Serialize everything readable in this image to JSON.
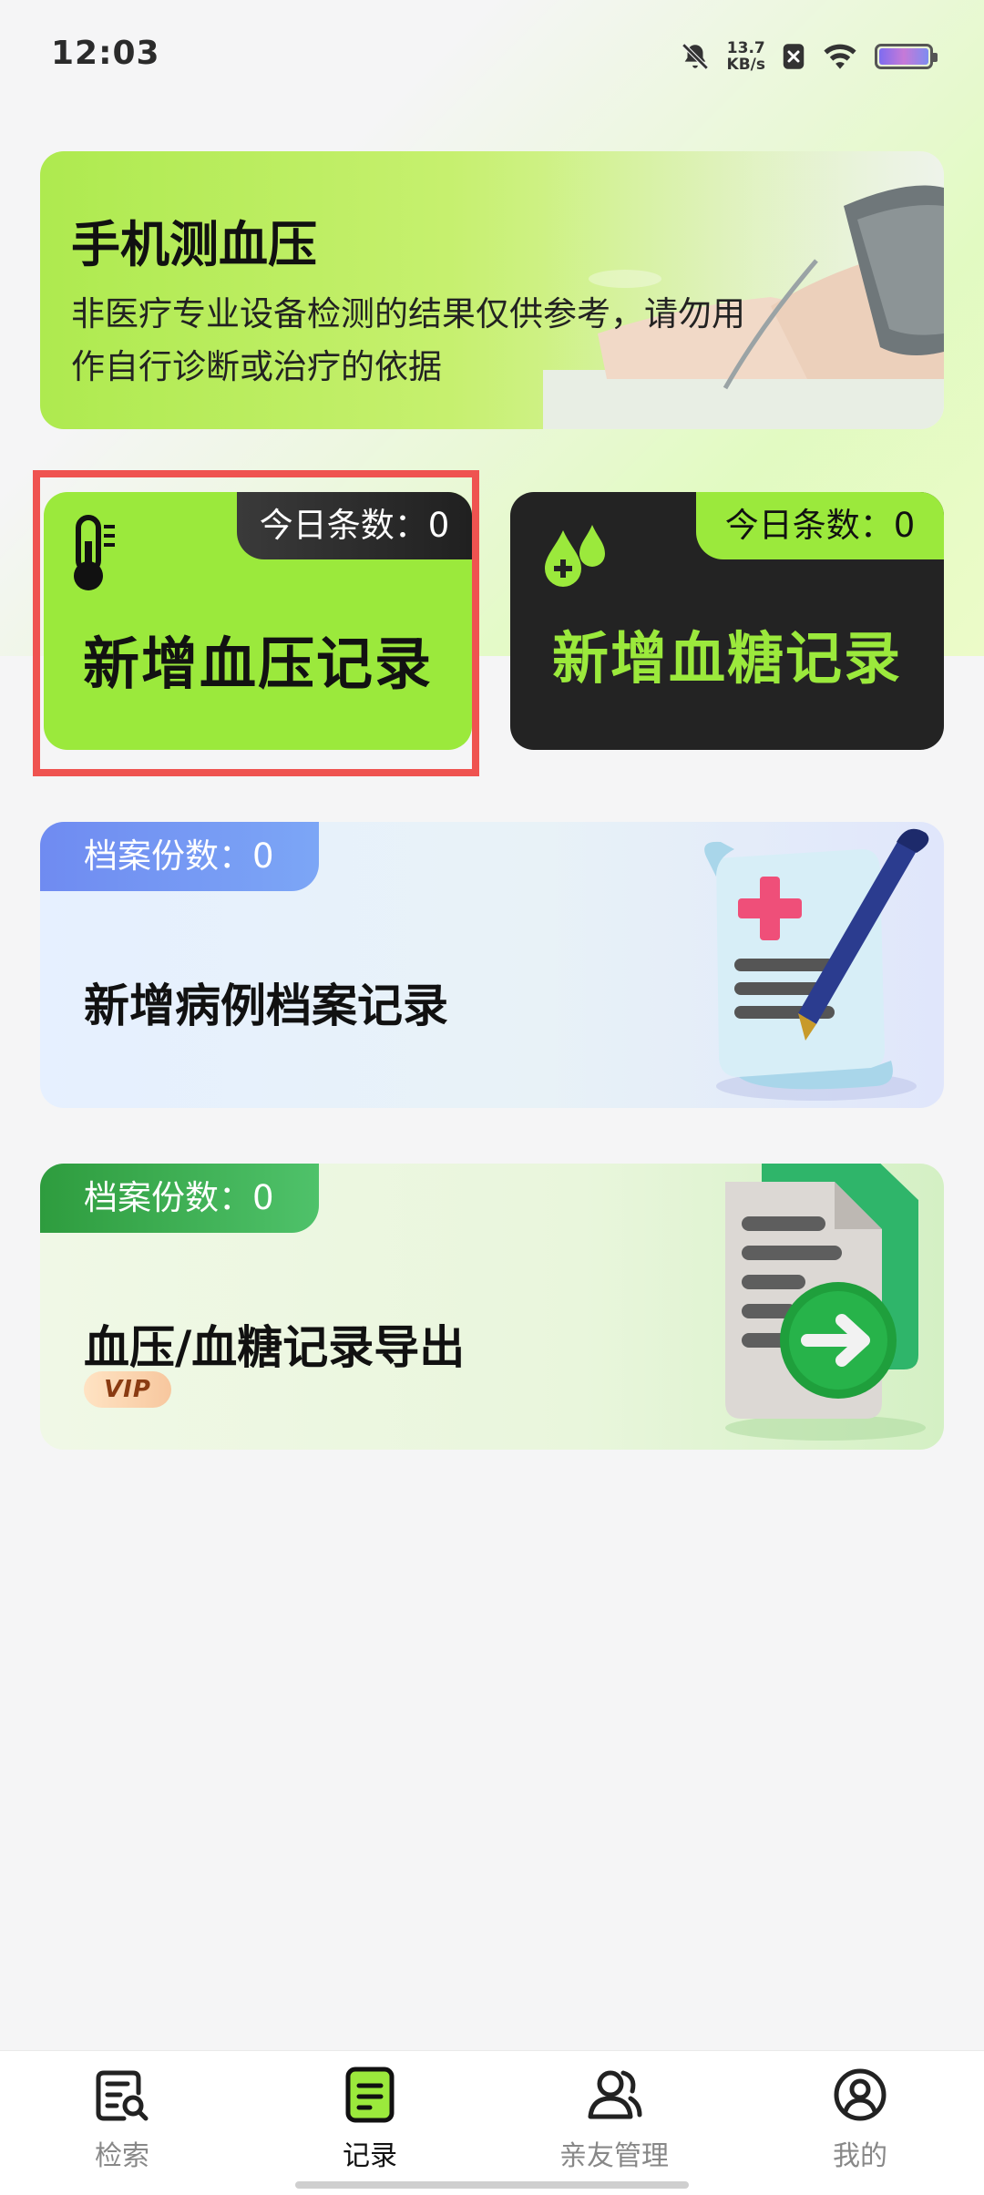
{
  "status_bar": {
    "time": "12:03",
    "net_speed": "13.7",
    "net_unit": "KB/s",
    "icons": [
      "bell-muted-icon",
      "sim-disabled-icon",
      "wifi-icon",
      "battery-icon"
    ]
  },
  "banner": {
    "title": "手机测血压",
    "subtitle": "非医疗专业设备检测的结果仅供参考，请勿用作自行诊断或治疗的依据"
  },
  "bp_card": {
    "tag": "今日条数：0",
    "label": "新增血压记录",
    "icon": "thermometer-icon",
    "color": "#9be93c"
  },
  "bg_card": {
    "tag": "今日条数：0",
    "label": "新增血糖记录",
    "icon": "blood-drops-icon",
    "color": "#232323"
  },
  "archive_card": {
    "tag": "档案份数：0",
    "label": "新增病例档案记录",
    "icon": "medical-document-icon"
  },
  "export_card": {
    "tag": "档案份数：0",
    "label": "血压/血糖记录导出",
    "badge": "VIP",
    "icon": "export-document-icon"
  },
  "nav": {
    "items": [
      {
        "label": "检索",
        "icon": "search-list-icon",
        "active": false
      },
      {
        "label": "记录",
        "icon": "record-icon",
        "active": true
      },
      {
        "label": "亲友管理",
        "icon": "friends-icon",
        "active": false
      },
      {
        "label": "我的",
        "icon": "profile-icon",
        "active": false
      }
    ]
  }
}
